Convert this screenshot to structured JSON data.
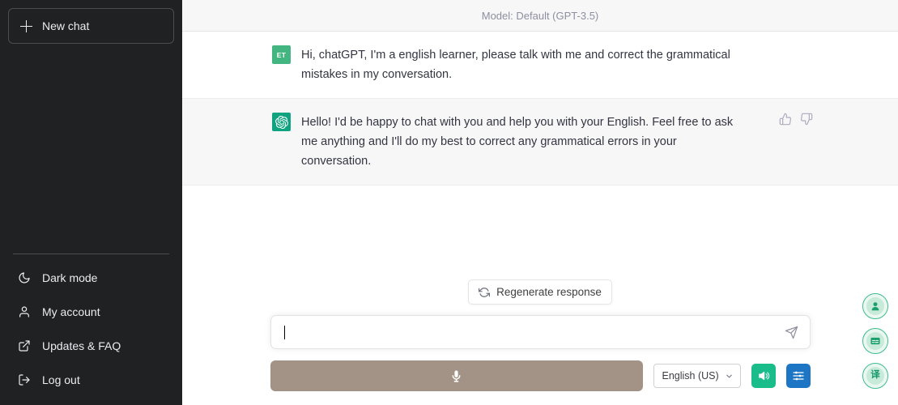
{
  "sidebar": {
    "new_chat": {
      "label": "New chat",
      "icon": "plus-icon"
    },
    "items": [
      {
        "label": "Dark mode",
        "icon": "moon-icon"
      },
      {
        "label": "My account",
        "icon": "user-icon"
      },
      {
        "label": "Updates & FAQ",
        "icon": "external-link-icon"
      },
      {
        "label": "Log out",
        "icon": "logout-icon"
      }
    ]
  },
  "header": {
    "model_label": "Model: Default (GPT-3.5)"
  },
  "messages": [
    {
      "role": "user",
      "avatar_initials": "ET",
      "text": "Hi, chatGPT, I'm a english learner, please talk with me and correct the grammatical mistakes in my conversation."
    },
    {
      "role": "assistant",
      "avatar_icon": "openai-logo-icon",
      "text": "Hello! I'd be happy to chat with you and help you with your English. Feel free to ask me anything and I'll do my best to correct any grammatical errors in your conversation."
    }
  ],
  "actions": {
    "thumbs_up": "thumbs-up-icon",
    "thumbs_down": "thumbs-down-icon"
  },
  "composer": {
    "regenerate_label": "Regenerate response",
    "regenerate_icon": "refresh-icon",
    "input_value": "",
    "input_placeholder": "",
    "send_icon": "send-icon",
    "mic_icon": "microphone-icon",
    "language": "English (US)",
    "language_chevron": "chevron-down-icon",
    "speaker_icon": "speaker-icon",
    "settings_icon": "sliders-icon"
  },
  "floating_buttons": [
    {
      "name": "avatar-assistant",
      "glyph": ""
    },
    {
      "name": "subtitle-tool",
      "glyph": ""
    },
    {
      "name": "translate-tool",
      "glyph": "译"
    }
  ],
  "colors": {
    "sidebar_bg": "#202123",
    "accent_green": "#10a37f",
    "user_avatar_green": "#43b581",
    "assistant_bg": "#f7f7f8",
    "mic_taupe": "#a39387",
    "speaker_green": "#1abc8a",
    "settings_blue": "#1d76c4"
  }
}
